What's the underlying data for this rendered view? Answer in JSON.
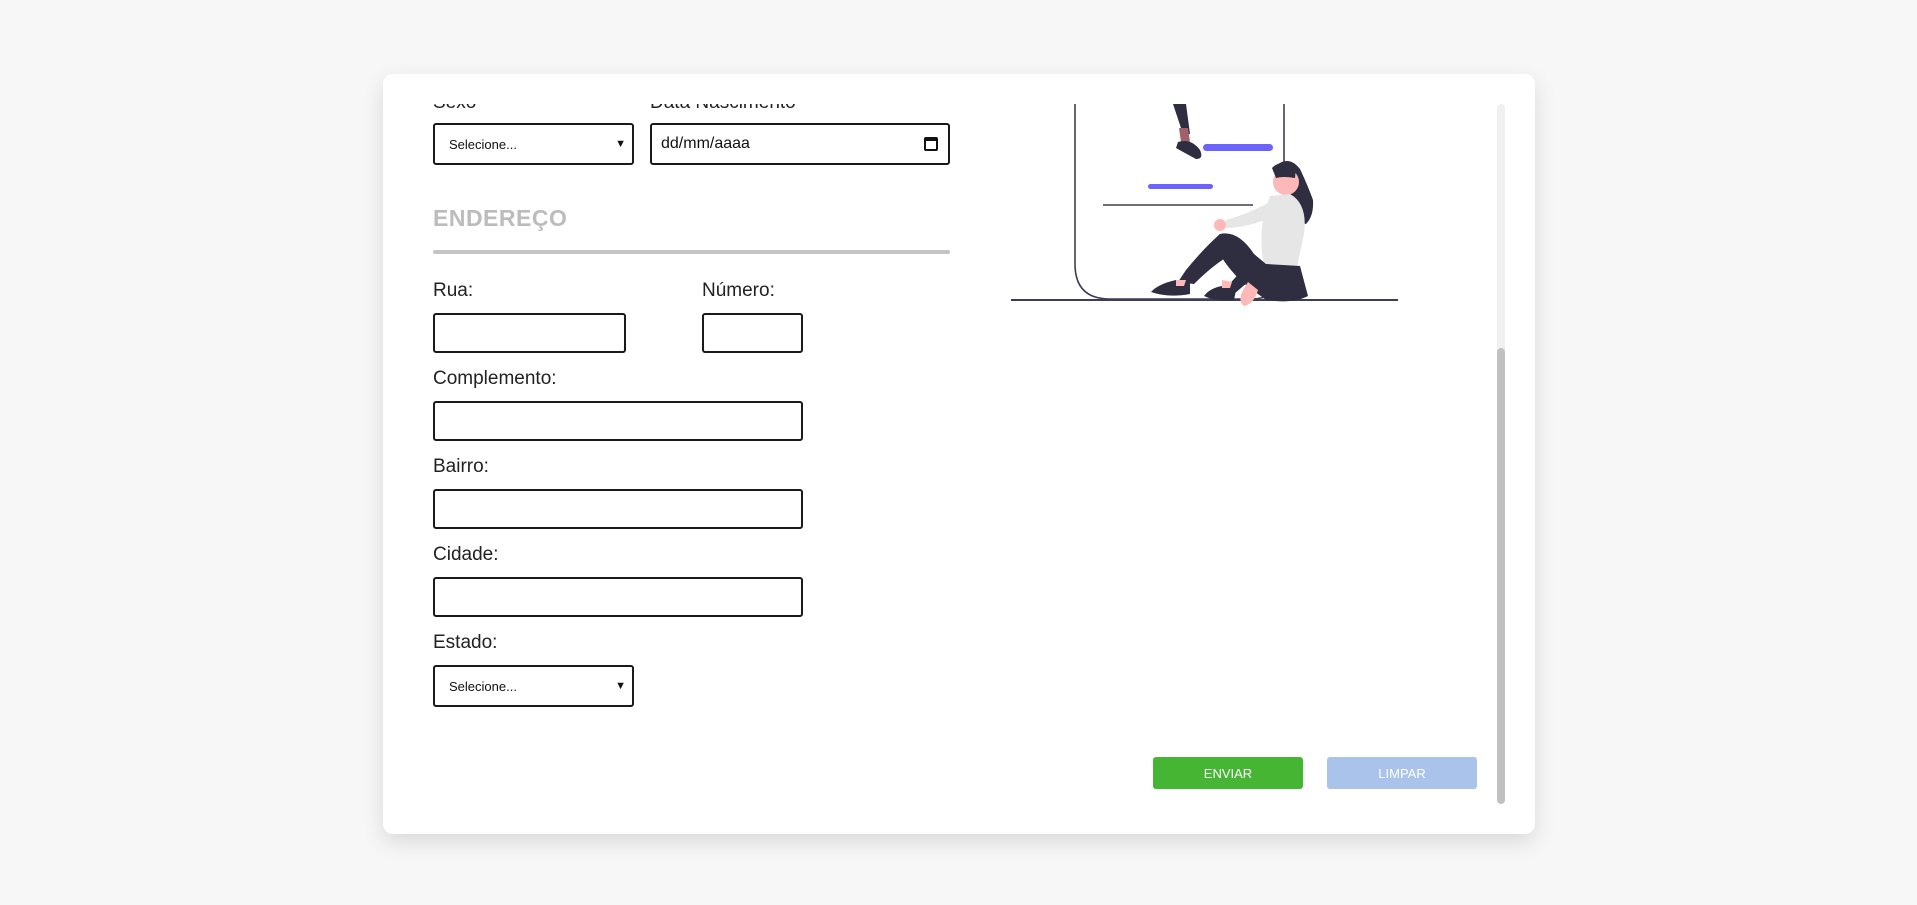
{
  "form": {
    "sexo": {
      "label": "Sexo",
      "selected": "Selecione..."
    },
    "data_nascimento": {
      "label": "Data Nascimento",
      "value": "dd/mm/aaaa"
    },
    "endereco_title": "ENDEREÇO",
    "rua": {
      "label": "Rua:",
      "value": ""
    },
    "numero": {
      "label": "Número:",
      "value": ""
    },
    "complemento": {
      "label": "Complemento:",
      "value": ""
    },
    "bairro": {
      "label": "Bairro:",
      "value": ""
    },
    "cidade": {
      "label": "Cidade:",
      "value": ""
    },
    "estado": {
      "label": "Estado:",
      "selected": "Selecione..."
    }
  },
  "actions": {
    "enviar_label": "ENVIAR",
    "limpar_label": "LIMPAR"
  },
  "colors": {
    "enviar": "#46b534",
    "limpar": "#a9c3ea",
    "illustration_accent": "#6c63ff"
  },
  "scrollbar": {
    "position_fraction": 0.35
  }
}
